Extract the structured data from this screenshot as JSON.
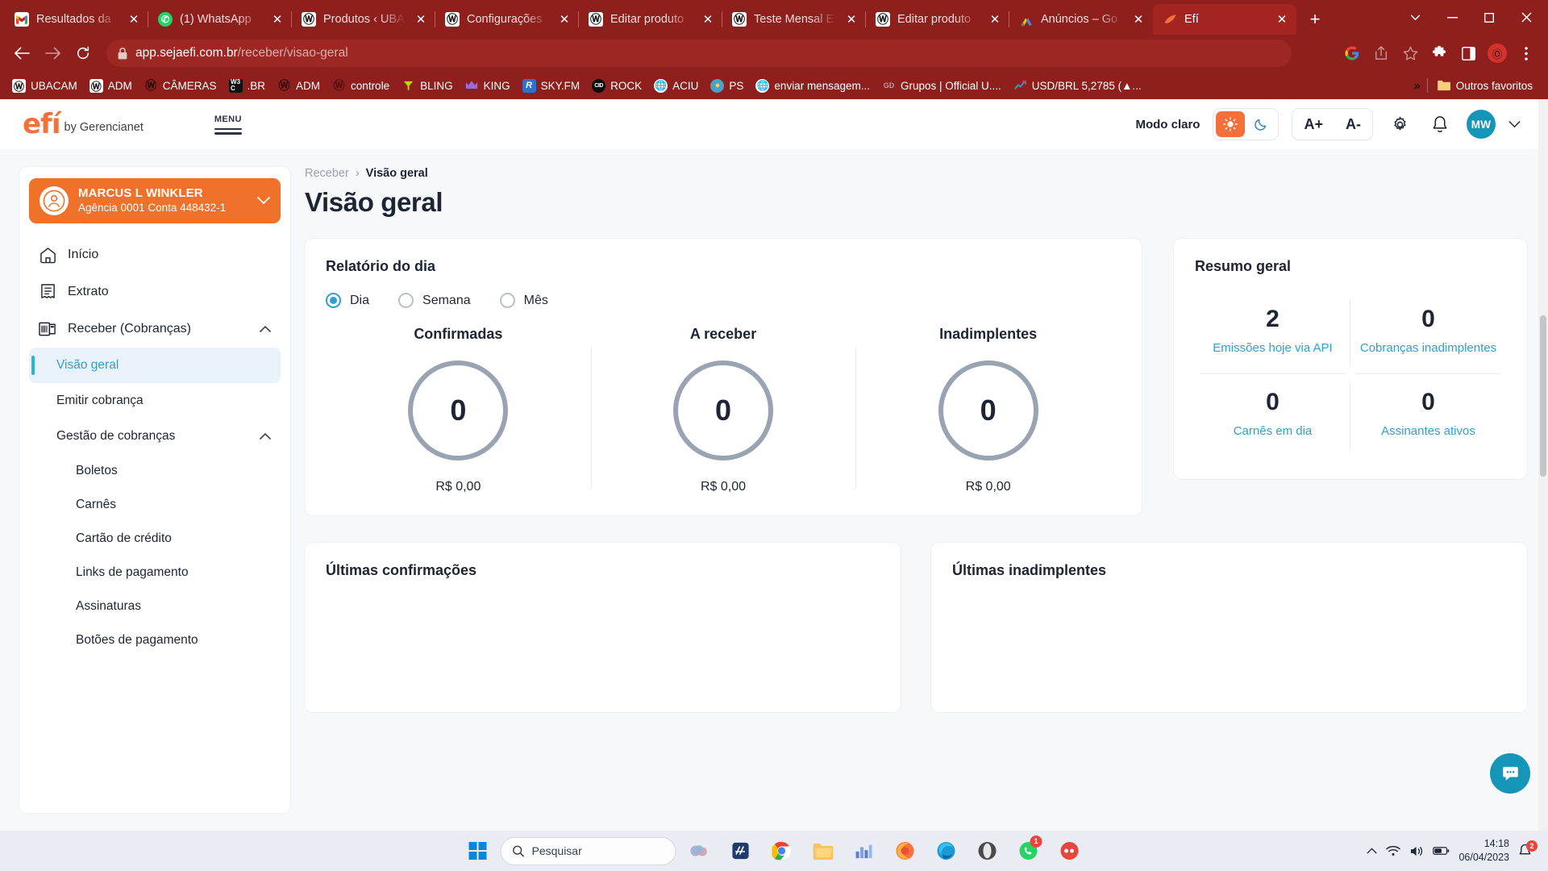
{
  "browser": {
    "tabs": [
      {
        "title": "Resultados da",
        "favicon": "gmail-icon",
        "active": false
      },
      {
        "title": "(1) WhatsApp",
        "favicon": "whatsapp-icon",
        "active": false
      },
      {
        "title": "Produtos ‹ UBA",
        "favicon": "wordpress-icon",
        "active": false
      },
      {
        "title": "Configurações",
        "favicon": "wordpress-icon",
        "active": false
      },
      {
        "title": "Editar produto",
        "favicon": "wordpress-icon",
        "active": false
      },
      {
        "title": "Teste Mensal E",
        "favicon": "wordpress-icon",
        "active": false
      },
      {
        "title": "Editar produto",
        "favicon": "wordpress-icon",
        "active": false
      },
      {
        "title": "Anúncios – Go",
        "favicon": "google-ads-icon",
        "active": false
      },
      {
        "title": "Efí",
        "favicon": "efi-icon",
        "active": true
      }
    ],
    "new_tab_label": "+",
    "window_controls": {
      "history": "⌄",
      "minimize": "─",
      "maximize": "☐",
      "close": "✕"
    },
    "omnibox": {
      "host": "app.sejaefi.com.br",
      "path": "/receber/visao-geral",
      "lock": "lock-icon"
    },
    "toolbar_right_icons": [
      "google-icon",
      "share-icon",
      "bookmark-star-icon",
      "extensions-icon",
      "sidepanel-icon",
      "profile-icon",
      "menu-kebab-icon"
    ],
    "bookmarks": [
      {
        "label": "UBACAM",
        "icon": "wordpress-icon"
      },
      {
        "label": "ADM",
        "icon": "wordpress-icon"
      },
      {
        "label": "CÂMERAS",
        "icon": "wordpress-icon"
      },
      {
        "label": ".BR",
        "icon": "w3c-icon"
      },
      {
        "label": "ADM",
        "icon": "wordpress-icon"
      },
      {
        "label": "controle",
        "icon": "wordpress-icon"
      },
      {
        "label": "BLING",
        "icon": "bling-icon"
      },
      {
        "label": "KING",
        "icon": "crown-icon"
      },
      {
        "label": "SKY.FM",
        "icon": "radio-icon"
      },
      {
        "label": "ROCK",
        "icon": "cid-icon"
      },
      {
        "label": "ACIU",
        "icon": "globe-icon"
      },
      {
        "label": "PS",
        "icon": "ps-icon"
      },
      {
        "label": "enviar mensagem...",
        "icon": "globe-icon"
      },
      {
        "label": "Grupos | Official U....",
        "icon": "gd-icon"
      },
      {
        "label": "USD/BRL 5,2785 (▲...",
        "icon": "google-finance-icon"
      }
    ],
    "bookmarks_overflow": "»",
    "other_bookmarks": {
      "label": "Outros favoritos",
      "icon": "folder-icon"
    }
  },
  "app_header": {
    "logo_text": "efí",
    "logo_suffix": "by Gerencianet",
    "menu_label": "MENU",
    "theme": {
      "label": "Modo claro",
      "light_icon": "sun-icon",
      "dark_icon": "moon-icon",
      "selected": "light"
    },
    "font_size": {
      "increase": "A+",
      "decrease": "A-"
    },
    "settings_icon": "gear-icon",
    "notifications_icon": "bell-icon",
    "avatar_initials": "MW",
    "avatar_chevron": "chevron-down-icon"
  },
  "sidebar": {
    "account": {
      "name": "MARCUS L WINKLER",
      "details": "Agência 0001  Conta 448432-1",
      "avatar_icon": "user-circle-icon",
      "chevron": "chevron-down-icon"
    },
    "nav": [
      {
        "label": "Início",
        "icon": "home-icon"
      },
      {
        "label": "Extrato",
        "icon": "receipt-icon"
      },
      {
        "label": "Receber (Cobranças)",
        "icon": "invoice-icon",
        "expanded": true
      }
    ],
    "subnav": [
      {
        "label": "Visão geral",
        "active": true
      },
      {
        "label": "Emitir cobrança",
        "active": false
      },
      {
        "label": "Gestão de cobranças",
        "active": false,
        "expanded": true
      }
    ],
    "subsubnav": [
      {
        "label": "Boletos"
      },
      {
        "label": "Carnês"
      },
      {
        "label": "Cartão de crédito"
      },
      {
        "label": "Links de pagamento"
      },
      {
        "label": "Assinaturas"
      },
      {
        "label": "Botões de pagamento"
      }
    ]
  },
  "main": {
    "breadcrumb": {
      "parent": "Receber",
      "separator": "›",
      "current": "Visão geral"
    },
    "page_title": "Visão geral",
    "report_card": {
      "title": "Relatório do dia",
      "period_options": [
        {
          "label": "Dia",
          "selected": true
        },
        {
          "label": "Semana",
          "selected": false
        },
        {
          "label": "Mês",
          "selected": false
        }
      ],
      "metrics": [
        {
          "label": "Confirmadas",
          "count": "0",
          "amount": "R$ 0,00"
        },
        {
          "label": "A receber",
          "count": "0",
          "amount": "R$ 0,00"
        },
        {
          "label": "Inadimplentes",
          "count": "0",
          "amount": "R$ 0,00"
        }
      ]
    },
    "summary_card": {
      "title": "Resumo geral",
      "cells": [
        {
          "value": "2",
          "label": "Emissões hoje via API"
        },
        {
          "value": "0",
          "label": "Cobranças inadimplentes"
        },
        {
          "value": "0",
          "label": "Carnês em dia"
        },
        {
          "value": "0",
          "label": "Assinantes ativos"
        }
      ]
    },
    "lower_cards": [
      {
        "title": "Últimas confirmações"
      },
      {
        "title": "Últimas inadimplentes"
      }
    ],
    "chat_fab_icon": "chat-support-icon",
    "accent_color": "#F3703A",
    "link_color": "#2f9fd0"
  },
  "taskbar": {
    "start_icon": "windows-icon",
    "search": {
      "icon": "search-icon",
      "placeholder": "Pesquisar"
    },
    "apps": [
      {
        "name": "widgets-icon",
        "badge": ""
      },
      {
        "name": "editor-icon",
        "badge": ""
      },
      {
        "name": "chrome-icon",
        "badge": ""
      },
      {
        "name": "file-explorer-icon",
        "badge": ""
      },
      {
        "name": "store-icon",
        "badge": ""
      },
      {
        "name": "firefox-icon",
        "badge": ""
      },
      {
        "name": "edge-icon",
        "badge": ""
      },
      {
        "name": "opera-icon",
        "badge": ""
      },
      {
        "name": "whatsapp-icon",
        "badge": "1"
      },
      {
        "name": "messenger-icon",
        "badge": ""
      }
    ],
    "tray": {
      "chevron": "chevron-up-icon",
      "wifi": "wifi-icon",
      "volume": "volume-icon",
      "battery": "battery-icon",
      "time": "14:18",
      "date": "06/04/2023",
      "notification": "2"
    }
  }
}
